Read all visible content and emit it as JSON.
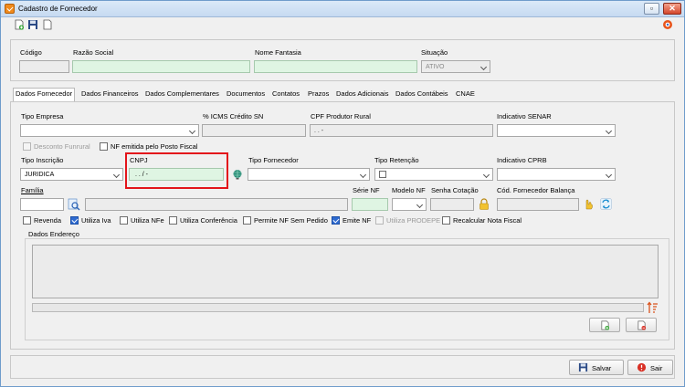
{
  "window": {
    "title": "Cadastro de Fornecedor"
  },
  "header": {
    "codigo_label": "Código",
    "razao_social_label": "Razão Social",
    "nome_fantasia_label": "Nome Fantasia",
    "situacao_label": "Situação",
    "situacao_value": "ATIVO"
  },
  "tabs": [
    "Dados Fornecedor",
    "Dados Financeiros",
    "Dados Complementares",
    "Documentos",
    "Contatos",
    "Prazos",
    "Dados Adicionais",
    "Dados Contábeis",
    "CNAE"
  ],
  "form": {
    "tipo_empresa_label": "Tipo Empresa",
    "icms_label": "% ICMS Crédito SN",
    "cpf_produtor_label": "CPF Produtor Rural",
    "cpf_produtor_value": ". . -",
    "indicativo_senar_label": "Indicativo SENAR",
    "desconto_funrural_label": "Desconto Funrural",
    "nf_posto_fiscal_label": "NF emitida pelo Posto Fiscal",
    "tipo_inscricao_label": "Tipo Inscrição",
    "tipo_inscricao_value": "JURIDICA",
    "cnpj_label": "CNPJ",
    "cnpj_value": ". . / -",
    "tipo_fornecedor_label": "Tipo Fornecedor",
    "tipo_retencao_label": "Tipo Retenção",
    "indicativo_cprb_label": "Indicativo CPRB",
    "familia_label": "Família",
    "serie_nf_label": "Série NF",
    "modelo_nf_label": "Modelo NF",
    "senha_cotacao_label": "Senha Cotação",
    "cod_fornecedor_balanca_label": "Cód. Fornecedor Balança"
  },
  "checkboxes": [
    {
      "label": "Revenda",
      "checked": false
    },
    {
      "label": "Utiliza Iva",
      "checked": true
    },
    {
      "label": "Utiliza NFe",
      "checked": false
    },
    {
      "label": "Utiliza Conferência",
      "checked": false
    },
    {
      "label": "Permite NF Sem Pedido",
      "checked": false
    },
    {
      "label": "Emite NF",
      "checked": true
    },
    {
      "label": "Utiliza PRODEPE",
      "checked": false,
      "disabled": true
    },
    {
      "label": "Recalcular Nota Fiscal",
      "checked": false
    }
  ],
  "endereco": {
    "title": "Dados Endereço"
  },
  "footer": {
    "salvar_label": "Salvar",
    "sair_label": "Sair"
  },
  "colors": {
    "accent_highlight": "#e3141b",
    "field_mint": "#dff5e3",
    "checkbox_on": "#2e6bd1"
  }
}
